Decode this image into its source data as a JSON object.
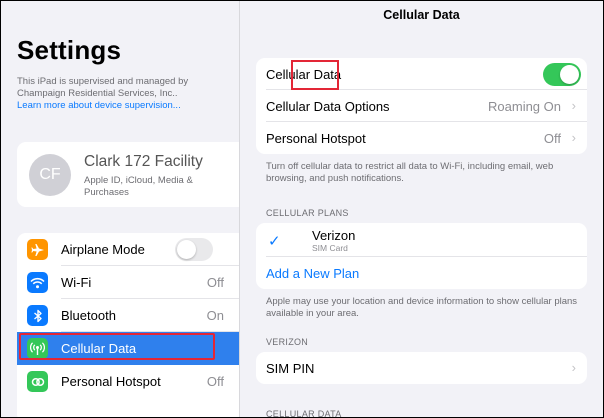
{
  "left": {
    "title": "Settings",
    "supervision_text": "This iPad is supervised and managed by Champaign Residential Services, Inc..",
    "supervision_link": "Learn more about device supervision...",
    "profile": {
      "initials": "CF",
      "name": "Clark 172 Facility",
      "subtitle": "Apple ID, iCloud, Media & Purchases"
    },
    "menu": [
      {
        "label": "Airplane Mode",
        "icon": "airplane-icon",
        "color": "#ff9500",
        "toggle": "off"
      },
      {
        "label": "Wi-Fi",
        "icon": "wifi-icon",
        "color": "#0a7aff",
        "value": "Off"
      },
      {
        "label": "Bluetooth",
        "icon": "bluetooth-icon",
        "color": "#0a7aff",
        "value": "On"
      },
      {
        "label": "Cellular Data",
        "icon": "antenna-icon",
        "color": "#34c759",
        "selected": true
      },
      {
        "label": "Personal Hotspot",
        "icon": "hotspot-icon",
        "color": "#34c759",
        "value": "Off"
      }
    ]
  },
  "right": {
    "title": "Cellular Data",
    "main_group": {
      "cellular_data": {
        "label": "Cellular Data",
        "toggle": "on"
      },
      "options": {
        "label": "Cellular Data Options",
        "value": "Roaming On"
      },
      "hotspot": {
        "label": "Personal Hotspot",
        "value": "Off"
      }
    },
    "main_footnote": "Turn off cellular data to restrict all data to Wi-Fi, including email, web browsing, and push notifications.",
    "plans_header": "CELLULAR PLANS",
    "plan": {
      "name": "Verizon",
      "subtitle": "SIM Card"
    },
    "add_plan": "Add a New Plan",
    "plans_footnote": "Apple may use your location and device information to show cellular plans available in your area.",
    "verizon_header": "VERIZON",
    "sim_pin": "SIM PIN",
    "cellular_data_header": "CELLULAR DATA"
  },
  "colors": {
    "accent": "#0a7aff",
    "selection": "#2f80ed",
    "toggle_on": "#34c759",
    "annotation_box": "#e32636"
  }
}
